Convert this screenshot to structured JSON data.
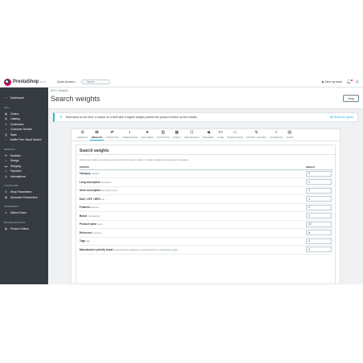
{
  "app": {
    "logo_name": "PrestaShop",
    "version": "8.1.6",
    "quick_access": "Quick Access",
    "search_placeholder": "Search",
    "view_store": "View my store"
  },
  "sidebar": {
    "dashboard": "Dashboard",
    "sections": [
      {
        "title": "SELL",
        "items": [
          "Orders",
          "Catalog",
          "Customers",
          "Customer Service",
          "Stats",
          "Mollie Free Visual Search"
        ]
      },
      {
        "title": "IMPROVE",
        "items": [
          "Modules",
          "Design",
          "Shipping",
          "Payment",
          "International"
        ]
      },
      {
        "title": "CONFIGURE",
        "items": [
          "Shop Parameters",
          "Advanced Parameters"
        ]
      },
      {
        "title": "COMMUNITY",
        "items": [
          "Wall of Fame"
        ]
      },
      {
        "title": "BRAND MODULES",
        "items": [
          "Product Videos"
        ]
      }
    ]
  },
  "header": {
    "breadcrumb": "iNFO / Weights",
    "title": "Search weights",
    "help": "Help"
  },
  "alert": {
    "text": "Relevance is set here: a match on a field with a higher weight pushes the product further up the results.",
    "guide": "Read the guide"
  },
  "tabs": [
    "GENERAL",
    "WEIGHTS",
    "SYNONYMS",
    "APPEARANCE",
    "FEATURED",
    "STATISTICS",
    "FEEDS",
    "WEB SEARCH",
    "BANNERS",
    "CODE",
    "PROMOTIONS",
    "IMPORT / EXPORT",
    "AI SERVICE",
    "GUIDE"
  ],
  "card": {
    "title": "Search weights",
    "description": "Define the relative importance of each field in search results. A higher weight means greater relevance.",
    "col_source": "SOURCE",
    "col_weight": "WEIGHT",
    "rows": [
      {
        "label": "Category",
        "note": "category",
        "weight": "3"
      },
      {
        "label": "Long description",
        "note": "description",
        "weight": "2"
      },
      {
        "label": "Short description",
        "note": "description_short",
        "weight": "3"
      },
      {
        "label": "EAN / UPC / MPN",
        "note": "ean",
        "weight": "3"
      },
      {
        "label": "Features",
        "note": "features",
        "weight": "2"
      },
      {
        "label": "Brand",
        "note": "manufacturer",
        "weight": "3"
      },
      {
        "label": "Product name",
        "note": "name",
        "weight": "10"
      },
      {
        "label": "Reference",
        "note": "reference",
        "weight": "8"
      },
      {
        "label": "Tags",
        "note": "tags",
        "weight": "4"
      },
      {
        "label": "Manufacturer priority boost",
        "note": "boosts products supplied by a selected brand or manufacturer weight",
        "weight": "3"
      }
    ]
  }
}
